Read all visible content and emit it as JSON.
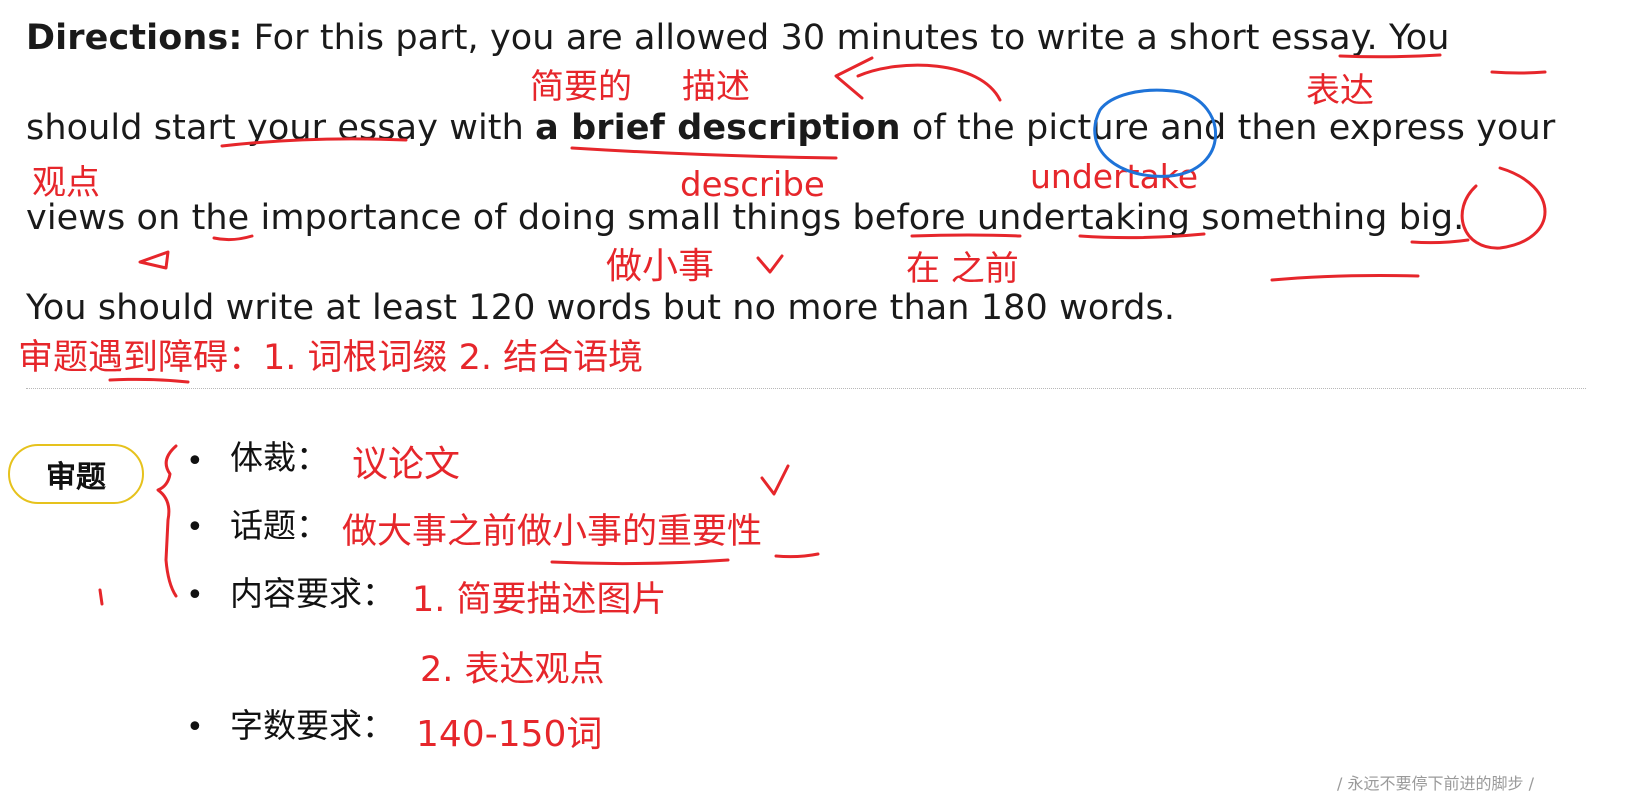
{
  "directions": {
    "label": "Directions:",
    "line1": " For this part, you are allowed 30 minutes to write a short essay. You",
    "line2_pre": "should start your essay with ",
    "line2_bold": "a brief description",
    "line2_post": " of the picture and then express your",
    "line3": "views on the importance of doing small things before undertaking something big.",
    "line4": "You should write at least 120 words but no more than 180 words."
  },
  "annotations": {
    "jianyaode": "简要的",
    "miaoshu": "描述",
    "biaoda": "表达",
    "guandian": "观点",
    "describe": "describe",
    "undertake": "undertake",
    "zuoxiaoshi": "做小事",
    "zaizhiqian": "在 之前",
    "obstacle": "审题遇到障碍：1. 词根词缀  2. 结合语境",
    "genre_value": "议论文",
    "topic_value": "做大事之前做小事的重要性",
    "content_value_1": "1. 简要描述图片",
    "content_value_2": "2. 表达观点",
    "wordcount_value": "140-150词"
  },
  "analysis": {
    "badge": "审题",
    "items": [
      {
        "label": "体裁："
      },
      {
        "label": "话题："
      },
      {
        "label": "内容要求："
      },
      {
        "label": "字数要求："
      }
    ],
    "bullet_symbol": "•"
  },
  "watermark": "/ 永远不要停下前进的脚步 /",
  "colors": {
    "ink_red": "#e6262b",
    "ink_blue": "#1e73d8",
    "badge_border": "#e6c21d"
  }
}
